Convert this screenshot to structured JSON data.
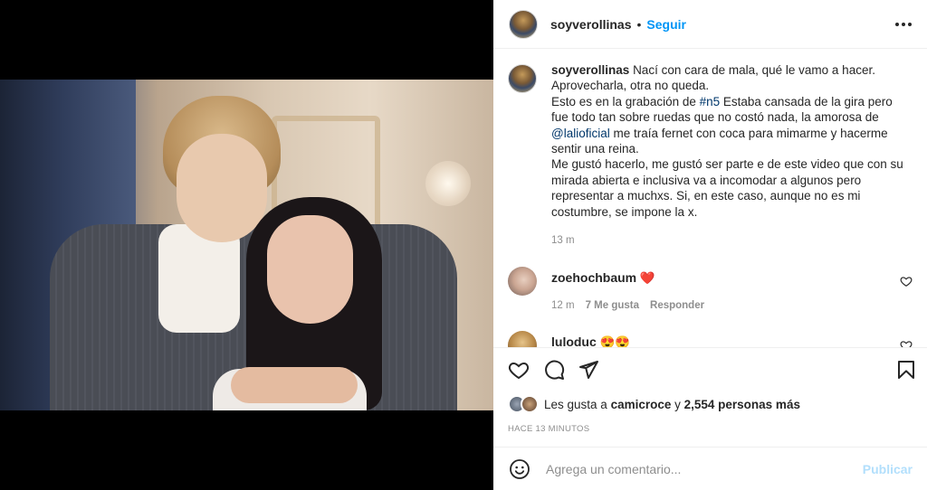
{
  "post": {
    "username": "soyverollinas",
    "follow_label": "Seguir",
    "separator": "•"
  },
  "caption": {
    "username": "soyverollinas",
    "line1": "Nací con cara de mala, qué le vamo a hacer.",
    "line2": "Aprovecharla, otra no queda.",
    "para2_a": "Esto es en la grabación de ",
    "hashtag": "#n5",
    "para2_b": " Estaba cansada de la gira pero fue todo tan sobre ruedas que no costó nada, la amorosa de ",
    "mention": "@lalioficial",
    "para2_c": " me traía fernet con coca para mimarme y hacerme sentir una reina.",
    "para3": "Me gustó hacerlo, me gustó ser parte e de este video que con su mirada abierta e inclusiva va a incomodar a algunos pero representar a muchxs. Si, en este caso, aunque no es mi costumbre, se impone la x.",
    "time": "13 m"
  },
  "comments": [
    {
      "username": "zoehochbaum",
      "emoji": "❤️",
      "time": "12 m",
      "likes": "7 Me gusta",
      "reply_label": "Responder"
    },
    {
      "username": "luloduc",
      "emoji": "😍😍"
    }
  ],
  "likes": {
    "prefix": "Les gusta a ",
    "user": "camicroce",
    "middle": " y ",
    "count": "2,554 personas más"
  },
  "posted_ago": "HACE 13 MINUTOS",
  "add_comment": {
    "placeholder": "Agrega un comentario...",
    "publish_label": "Publicar"
  },
  "colors": {
    "link_blue": "#0095f6",
    "mention_blue": "#00376b",
    "heart_red": "#ed4956",
    "muted": "#8e8e8e",
    "publish_disabled": "#b2dffc"
  },
  "icons": [
    "more-options-icon",
    "heart-icon",
    "comment-icon",
    "share-icon",
    "bookmark-icon",
    "emoji-icon"
  ]
}
